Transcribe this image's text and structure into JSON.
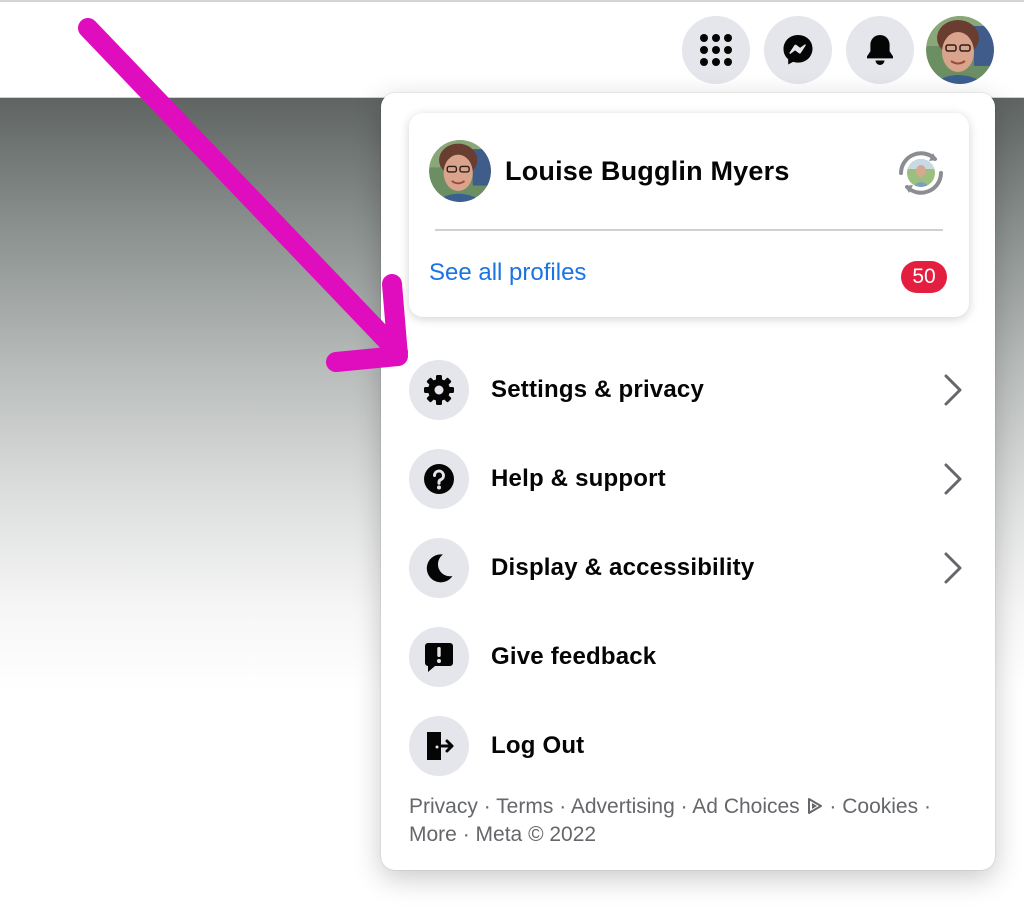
{
  "topbar": {
    "icons": [
      "menu-grid-icon",
      "messenger-icon",
      "notifications-bell-icon"
    ],
    "avatar": "profile-avatar"
  },
  "profile": {
    "name": "Louise Bugglin Myers",
    "see_all_label": "See all profiles",
    "badge_count": "50"
  },
  "menu": {
    "items": [
      {
        "label": "Settings & privacy",
        "icon": "gear-icon",
        "has_chevron": true
      },
      {
        "label": "Help & support",
        "icon": "question-icon",
        "has_chevron": true
      },
      {
        "label": "Display & accessibility",
        "icon": "moon-icon",
        "has_chevron": true
      },
      {
        "label": "Give feedback",
        "icon": "feedback-icon",
        "has_chevron": false
      },
      {
        "label": "Log Out",
        "icon": "logout-icon",
        "has_chevron": false
      }
    ]
  },
  "footer": {
    "privacy": "Privacy",
    "terms": "Terms",
    "advertising": "Advertising",
    "ad_choices": "Ad Choices",
    "cookies": "Cookies",
    "more": "More",
    "meta": "Meta © 2022",
    "separator": "·"
  },
  "colors": {
    "link_blue": "#1b74e4",
    "badge_red": "#e41e3f",
    "annotation_magenta": "#e00dbe",
    "icon_bg": "#e4e6eb"
  }
}
